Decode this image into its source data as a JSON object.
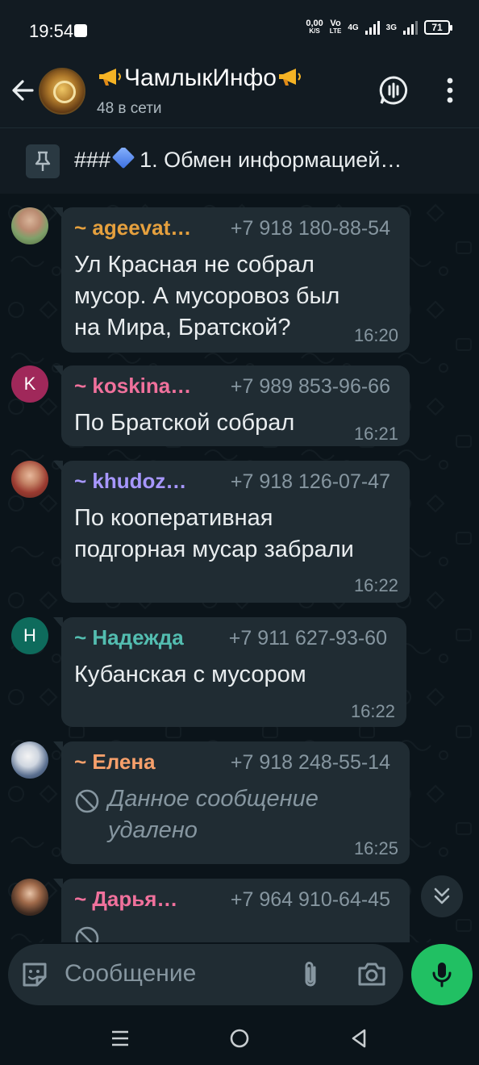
{
  "status_bar": {
    "time": "19:54",
    "net_speed_value": "0,00",
    "net_speed_unit": "K/S",
    "volte": "Vo",
    "volte_sub": "LTE",
    "sig1": "4G",
    "sig2": "3G",
    "battery": "71"
  },
  "header": {
    "title": "ЧамлыкИнфо",
    "subtitle": "48 в сети"
  },
  "pinned": {
    "prefix": "###",
    "text": "1. Обмен информацией…"
  },
  "messages": [
    {
      "sender": "~ ageevat…",
      "phone": "+7 918 180-88-54",
      "text": "Ул Красная не собрал\nмусор. А  мусоровоз был\nна Мира, Братской?",
      "time": "16:20",
      "sender_color": "#e5a03e",
      "avatar": "photo"
    },
    {
      "sender": "~ koskina…",
      "phone": "+7 989 853-96-66",
      "text": "По Братской собрал",
      "time": "16:21",
      "sender_color": "#f0719c",
      "avatar_letter": "K",
      "avatar_color": "#a0285a"
    },
    {
      "sender": "~ khudoz…",
      "phone": "+7 918 126-07-47",
      "text": "По кооперативная\nподгорная мусар забрали",
      "time": "16:22",
      "sender_color": "#a797ff",
      "avatar": "photo"
    },
    {
      "sender": "~ Надежда",
      "phone": "+7 911 627-93-60",
      "text": "Кубанская с мусором",
      "time": "16:22",
      "sender_color": "#53bdb0",
      "avatar_letter": "Н",
      "avatar_color": "#0e6b5c"
    },
    {
      "sender": "~ Елена",
      "phone": "+7 918 248-55-14",
      "text": "Данное сообщение\nудалено",
      "time": "16:25",
      "sender_color": "#f7a06b",
      "deleted": true,
      "avatar": "photo"
    },
    {
      "sender": "~ Дарья…",
      "phone": "+7 964 910-64-45",
      "text": "",
      "time": "",
      "sender_color": "#f0719c",
      "avatar": "photo"
    }
  ],
  "input": {
    "placeholder": "Сообщение"
  }
}
